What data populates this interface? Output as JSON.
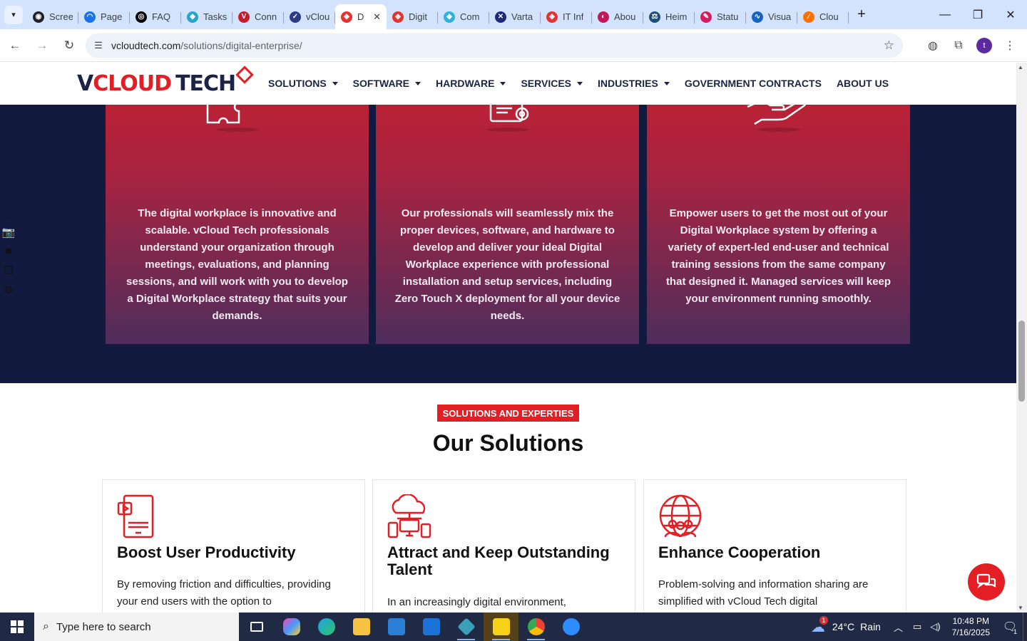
{
  "browser": {
    "tabs": [
      {
        "title": "Screenshot",
        "color": "#202124",
        "glyph": "◉"
      },
      {
        "title": "Page",
        "color": "#1a73e8",
        "glyph": "◠"
      },
      {
        "title": "FAQ",
        "color": "#000000",
        "glyph": "◎"
      },
      {
        "title": "Tasks",
        "color": "#26a5c9",
        "glyph": "◆"
      },
      {
        "title": "Conn",
        "color": "#c41d2a",
        "glyph": "V"
      },
      {
        "title": "vCloud",
        "color": "#2d3b86",
        "glyph": "✓"
      },
      {
        "title": "D",
        "color": "#e3342f",
        "glyph": "◈",
        "active": true
      },
      {
        "title": "Digit",
        "color": "#e3342f",
        "glyph": "◈"
      },
      {
        "title": "Com",
        "color": "#2db4d6",
        "glyph": "◆"
      },
      {
        "title": "Varta",
        "color": "#1e2a78",
        "glyph": "✕"
      },
      {
        "title": "IT Inf",
        "color": "#e3342f",
        "glyph": "◈"
      },
      {
        "title": "Abou",
        "color": "#c2185b",
        "glyph": "◐"
      },
      {
        "title": "Heim",
        "color": "#1f4e79",
        "glyph": "⚖"
      },
      {
        "title": "Statu",
        "color": "#d81b60",
        "glyph": "✎"
      },
      {
        "title": "Visua",
        "color": "#1565c0",
        "glyph": "∿"
      },
      {
        "title": "Clou",
        "color": "#ff6f00",
        "glyph": "∕"
      }
    ],
    "url_host": "vcloudtech.com",
    "url_path": "/solutions/digital-enterprise/",
    "profile_initial": "t"
  },
  "site": {
    "logo_v": "V",
    "logo_cloud": "CLOUD",
    "logo_tech": "TECH",
    "nav": [
      {
        "label": "SOLUTIONS",
        "dropdown": true
      },
      {
        "label": "SOFTWARE",
        "dropdown": true
      },
      {
        "label": "HARDWARE",
        "dropdown": true
      },
      {
        "label": "SERVICES",
        "dropdown": true
      },
      {
        "label": "INDUSTRIES",
        "dropdown": true
      },
      {
        "label": "GOVERNMENT CONTRACTS",
        "dropdown": false
      },
      {
        "label": "ABOUT US",
        "dropdown": false
      }
    ]
  },
  "process_cards": [
    {
      "icon": "puzzle-icon",
      "text": "The digital workplace is innovative and scalable. vCloud Tech professionals understand your organization through meetings, evaluations, and planning sessions, and will work with you to develop a Digital Workplace strategy that suits your demands."
    },
    {
      "icon": "document-gear-icon",
      "text": "Our professionals will seamlessly mix the proper devices, software, and hardware to develop and deliver your ideal Digital Workplace experience with professional installation and setup services, including Zero Touch X deployment for all your device needs."
    },
    {
      "icon": "support-hand-icon",
      "text": "Empower users to get the most out of your Digital Workplace system by offering a variety of expert-led end-user and technical training sessions from the same company that designed it. Managed services will keep your environment running smoothly."
    }
  ],
  "solutions": {
    "badge": "SOLUTIONS AND EXPERTIES",
    "title": "Our Solutions",
    "cards": [
      {
        "icon": "tablet-icon",
        "title": "Boost User Productivity",
        "text": "By removing friction and difficulties, providing your end users with the option to"
      },
      {
        "icon": "cloud-devices-icon",
        "title": "Attract and Keep Outstanding Talent",
        "text": "In an increasingly digital environment,"
      },
      {
        "icon": "globe-people-icon",
        "title": "Enhance Cooperation",
        "text": "Problem-solving and information sharing are simplified with vCloud Tech digital"
      }
    ]
  },
  "taskbar": {
    "search_placeholder": "Type here to search",
    "weather_temp": "24°C",
    "weather_desc": "Rain",
    "weather_badge": "1",
    "time": "10:48 PM",
    "date": "7/16/2025",
    "notif_count": "1"
  },
  "colors": {
    "brand_red": "#e31e24",
    "navy": "#121a40",
    "taskbar": "#202a44"
  }
}
